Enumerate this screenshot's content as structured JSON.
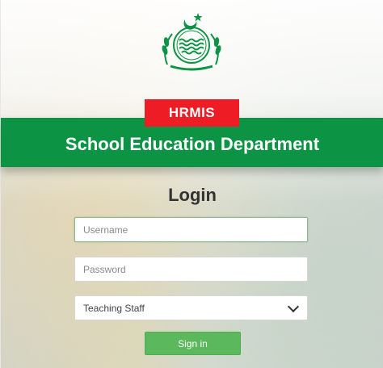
{
  "header": {
    "badge": "HRMIS",
    "department": "School Education Department"
  },
  "login": {
    "title": "Login",
    "username_placeholder": "Username",
    "password_placeholder": "Password",
    "staff_type_selected": "Teaching Staff",
    "signin_label": "Sign in"
  },
  "colors": {
    "banner_green": "#0c9444",
    "badge_red": "#ee1c24",
    "button_green": "#5cb85c"
  },
  "logo": {
    "icon": "punjab-government-emblem"
  }
}
